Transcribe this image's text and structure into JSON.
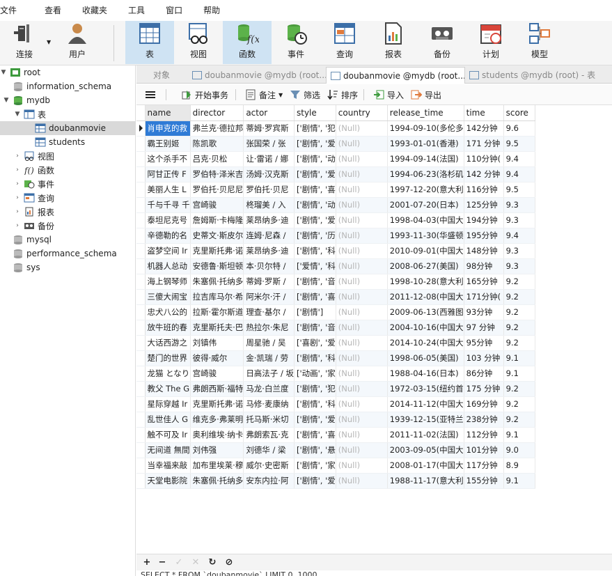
{
  "menu": [
    "文件",
    "查看",
    "收藏夹",
    "工具",
    "窗口",
    "帮助"
  ],
  "toolbar": {
    "connect": "连接",
    "user": "用户",
    "table": "表",
    "view": "视图",
    "function": "函数",
    "event": "事件",
    "query": "查询",
    "report": "报表",
    "backup": "备份",
    "schedule": "计划",
    "model": "模型"
  },
  "tree": {
    "root": "root",
    "information_schema": "information_schema",
    "mydb": "mydb",
    "tables": "表",
    "doubanmovie": "doubanmovie",
    "students": "students",
    "views": "视图",
    "functions": "函数",
    "events": "事件",
    "queries": "查询",
    "reports": "报表",
    "backups": "备份",
    "mysql": "mysql",
    "performance_schema": "performance_schema",
    "sys": "sys"
  },
  "tabs": {
    "objects": "对象",
    "tab1": "doubanmovie @mydb (root...",
    "tab2": "doubanmovie @mydb (root...",
    "tab3": "students @mydb (root) - 表"
  },
  "objbar": {
    "begin_tx": "开始事务",
    "note": "备注",
    "filter": "筛选",
    "sort": "排序",
    "import": "导入",
    "export": "导出"
  },
  "columns": [
    "name",
    "director",
    "actor",
    "style",
    "country",
    "release_time",
    "time",
    "score"
  ],
  "rows": [
    [
      "肖申克的救",
      "弗兰克·德拉邦",
      "蒂姆·罗宾斯",
      "['剧情', '犯",
      "(Null)",
      "1994-09-10(多伦多",
      "142分钟",
      "9.6"
    ],
    [
      "霸王别姬",
      "陈凯歌",
      "张国荣 / 张",
      "['剧情', '爱",
      "(Null)",
      "1993-01-01(香港)",
      "171 分钟",
      "9.5"
    ],
    [
      "这个杀手不",
      "吕克·贝松",
      "让·雷诺 / 娜",
      "['剧情', '动",
      "(Null)",
      "1994-09-14(法国)",
      "110分钟(",
      "9.4"
    ],
    [
      "阿甘正传 F",
      "罗伯特·泽米吉",
      "汤姆·汉克斯",
      "['剧情', '爱",
      "(Null)",
      "1994-06-23(洛杉矶",
      "142 分钟",
      "9.4"
    ],
    [
      "美丽人生 L",
      "罗伯托·贝尼尼",
      "罗伯托·贝尼",
      "['剧情', '喜",
      "(Null)",
      "1997-12-20(意大利",
      "116分钟",
      "9.5"
    ],
    [
      "千与千寻 千",
      "宫崎骏",
      "柊瑠美 / 入",
      "['剧情', '动",
      "(Null)",
      "2001-07-20(日本)",
      "125分钟",
      "9.3"
    ],
    [
      "泰坦尼克号",
      "詹姆斯·卡梅隆",
      "莱昂纳多·迪",
      "['剧情', '爱",
      "(Null)",
      "1998-04-03(中国大",
      "194分钟",
      "9.3"
    ],
    [
      "辛德勒的名",
      "史蒂文·斯皮尔",
      "连姆·尼森 /",
      "['剧情', '历",
      "(Null)",
      "1993-11-30(华盛顿",
      "195分钟",
      "9.4"
    ],
    [
      "盗梦空间 Ir",
      "克里斯托弗·诺",
      "莱昂纳多·迪",
      "['剧情', '科",
      "(Null)",
      "2010-09-01(中国大",
      "148分钟",
      "9.3"
    ],
    [
      "机器人总动",
      "安德鲁·斯坦顿",
      "本·贝尔特 /",
      "['爱情', '科",
      "(Null)",
      "2008-06-27(美国)",
      "98分钟",
      "9.3"
    ],
    [
      "海上钢琴师",
      "朱塞佩·托纳多",
      "蒂姆·罗斯 /",
      "['剧情', '音",
      "(Null)",
      "1998-10-28(意大利",
      "165分钟",
      "9.2"
    ],
    [
      "三傻大闹宝",
      "拉吉库马尔·希",
      "阿米尔·汗 /",
      "['剧情', '喜",
      "(Null)",
      "2011-12-08(中国大",
      "171分钟(",
      "9.2"
    ],
    [
      "忠犬八公的",
      "拉斯·霍尔斯道",
      "理查·基尔 /",
      "['剧情']",
      "(Null)",
      "2009-06-13(西雅图",
      "93分钟",
      "9.2"
    ],
    [
      "放牛班的春",
      "克里斯托夫·巴",
      "热拉尔·朱尼",
      "['剧情', '音",
      "(Null)",
      "2004-10-16(中国大",
      "97 分钟",
      "9.2"
    ],
    [
      "大话西游之",
      "刘镇伟",
      "周星驰 / 吴",
      "['喜剧', '爱",
      "(Null)",
      "2014-10-24(中国大",
      "95分钟",
      "9.2"
    ],
    [
      "楚门的世界",
      "彼得·威尔",
      "金·凯瑞 / 劳",
      "['剧情', '科",
      "(Null)",
      "1998-06-05(美国)",
      "103 分钟",
      "9.1"
    ],
    [
      "龙猫 となり",
      "宫崎骏",
      "日高法子 / 坂",
      "['动画', '家",
      "(Null)",
      "1988-04-16(日本)",
      "86分钟",
      "9.1"
    ],
    [
      "教父 The G",
      "弗朗西斯·福特",
      "马龙·白兰度",
      "['剧情', '犯",
      "(Null)",
      "1972-03-15(纽约首",
      "175 分钟",
      "9.2"
    ],
    [
      "星际穿越 Ir",
      "克里斯托弗·诺",
      "马修·麦康纳",
      "['剧情', '科",
      "(Null)",
      "2014-11-12(中国大",
      "169分钟",
      "9.2"
    ],
    [
      "乱世佳人 G",
      "维克多·弗莱明",
      "托马斯·米切",
      "['剧情', '爱",
      "(Null)",
      "1939-12-15(亚特兰",
      "238分钟",
      "9.2"
    ],
    [
      "触不可及 Ir",
      "奥利维埃·纳卡",
      "弗朗索瓦·克",
      "['剧情', '喜",
      "(Null)",
      "2011-11-02(法国)",
      "112分钟",
      "9.1"
    ],
    [
      "无间道 無間",
      "刘伟强",
      "刘德华 / 梁",
      "['剧情', '悬",
      "(Null)",
      "2003-09-05(中国大",
      "101分钟",
      "9.0"
    ],
    [
      "当幸福来敲",
      "加布里埃莱·穆",
      "威尔·史密斯",
      "['剧情', '家",
      "(Null)",
      "2008-01-17(中国大",
      "117分钟",
      "8.9"
    ],
    [
      "天堂电影院",
      "朱塞佩·托纳多",
      "安东内拉·阿",
      "['剧情', '爱",
      "(Null)",
      "1988-11-17(意大利",
      "155分钟",
      "9.1"
    ]
  ],
  "status": "SELECT * FROM `doubanmovie` LIMIT 0, 1000"
}
